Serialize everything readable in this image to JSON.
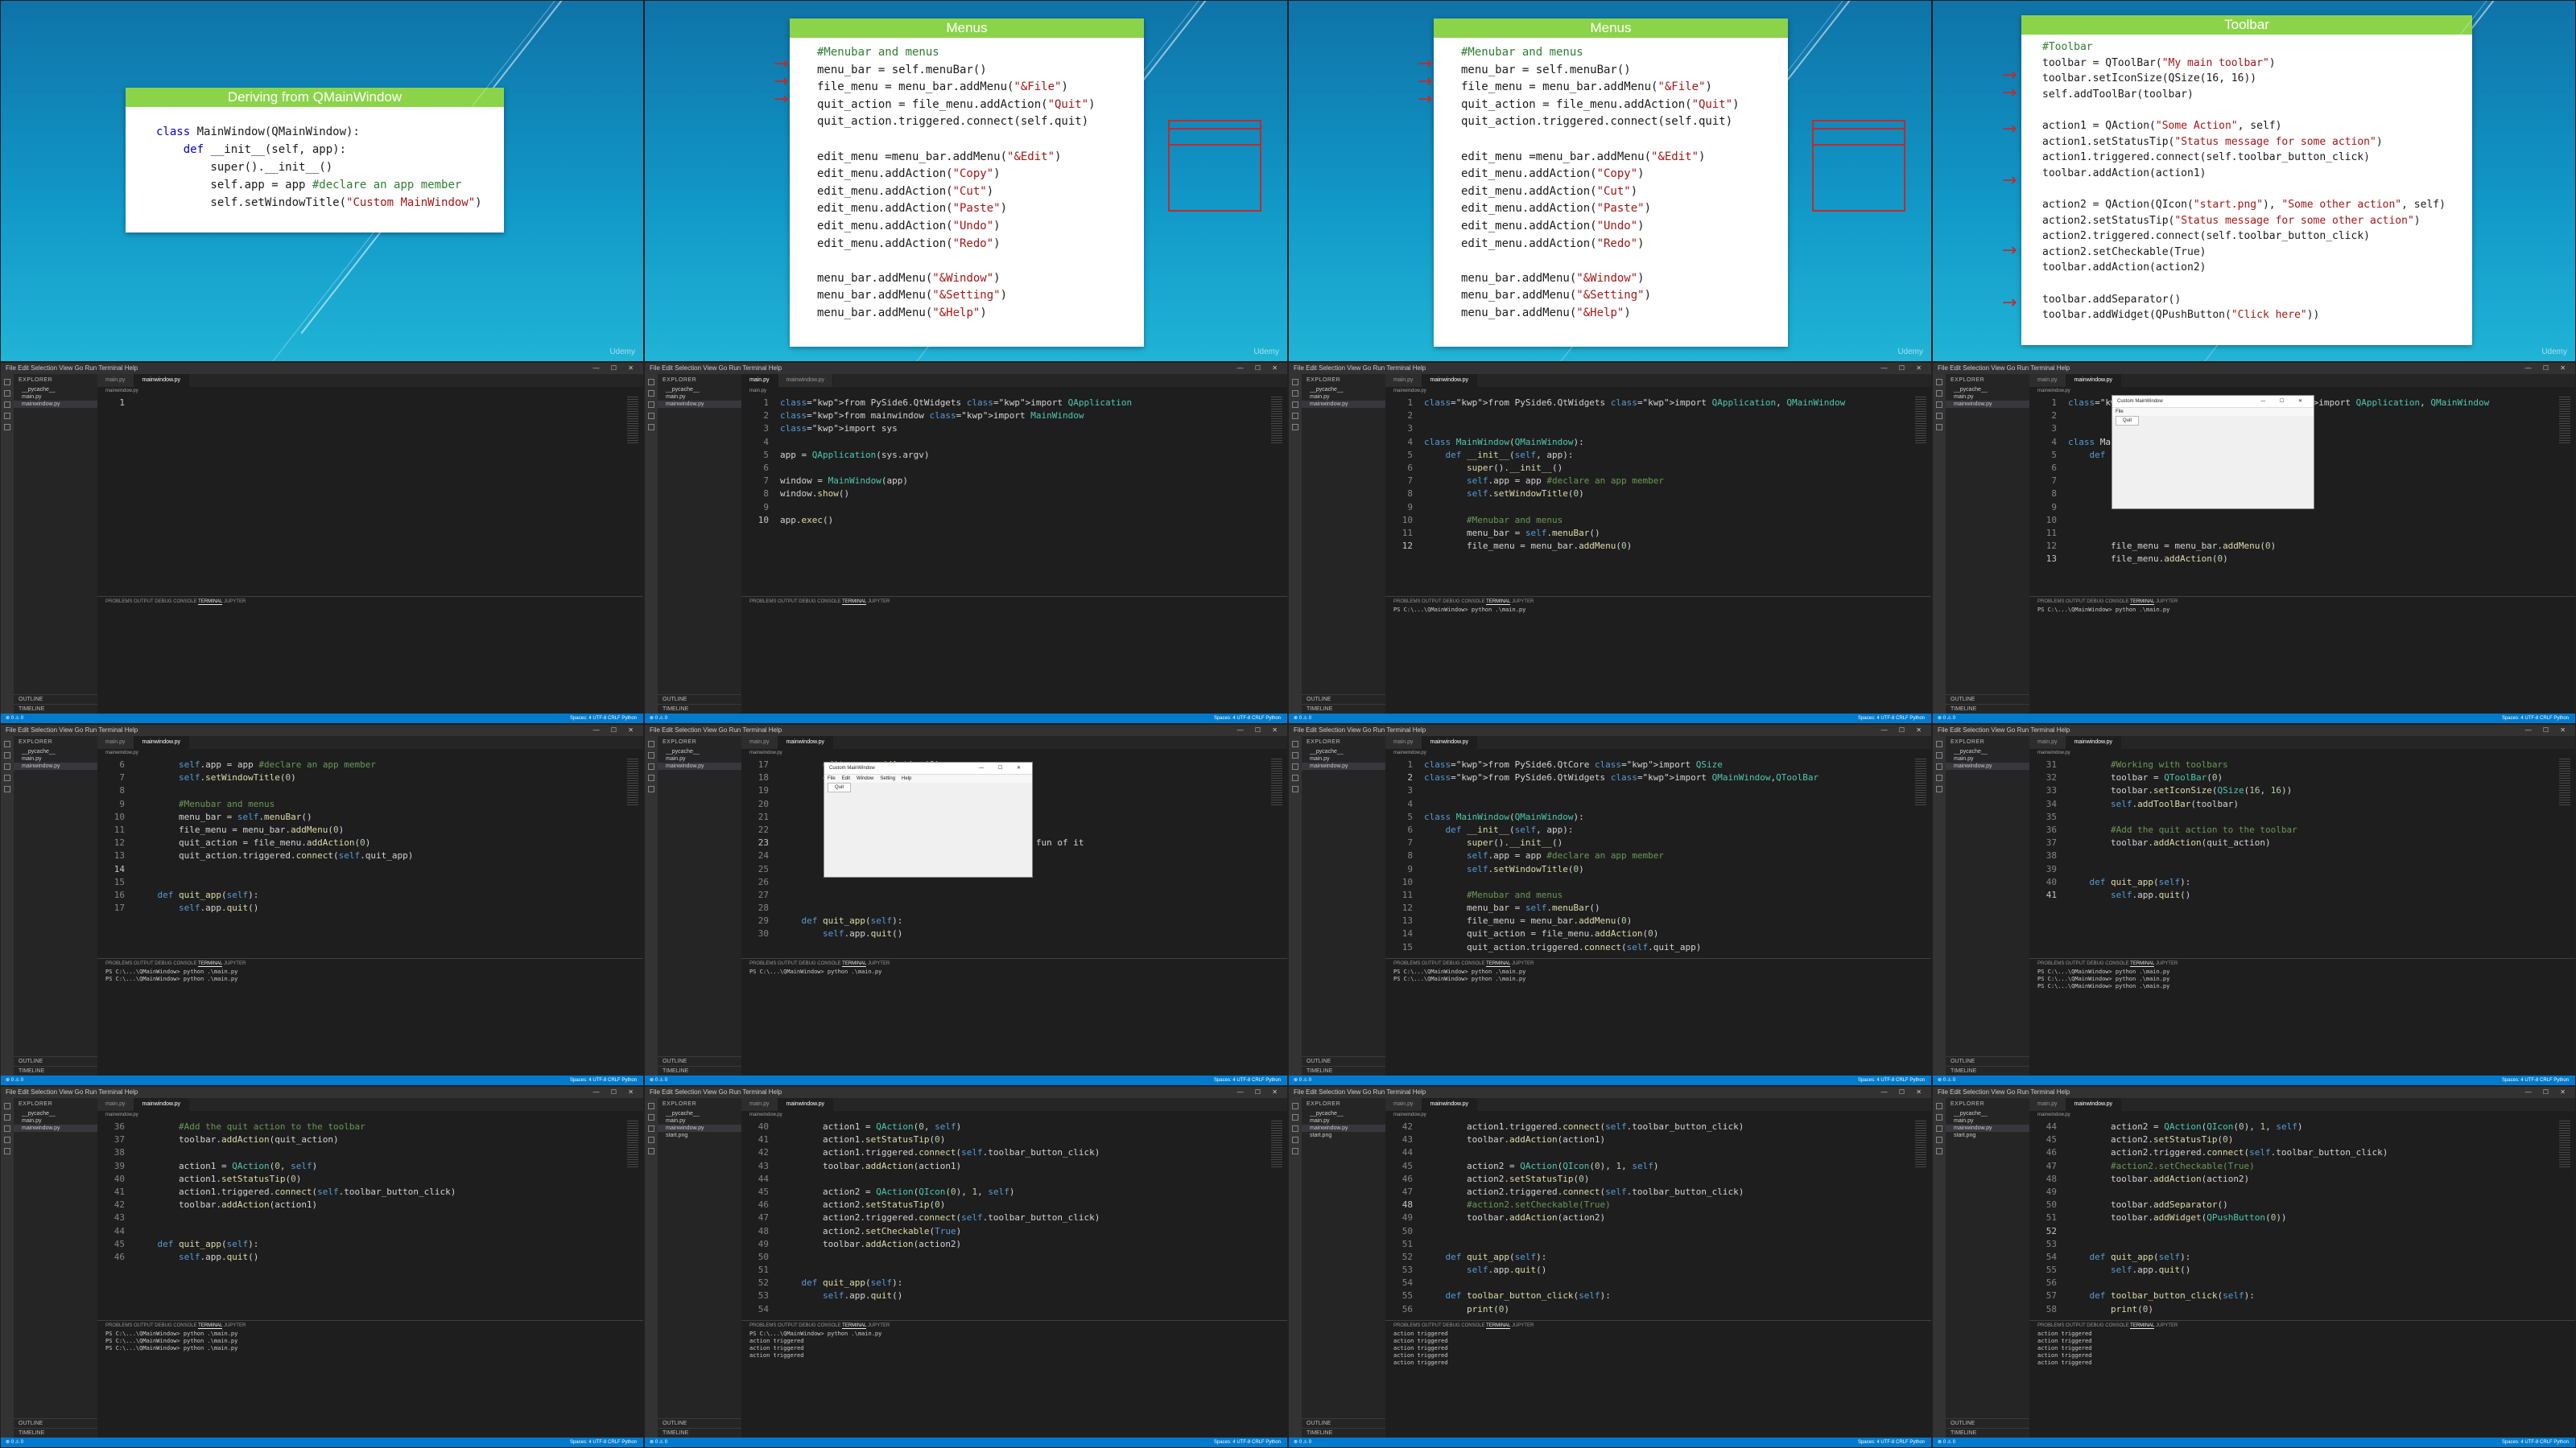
{
  "slides": [
    {
      "title": "Deriving from QMainWindow",
      "code": [
        "class MainWindow(QMainWindow):",
        "    def __init__(self, app):",
        "        super().__init__()",
        "        self.app = app #declare an app member",
        "        self.setWindowTitle(\"Custom MainWindow\")"
      ],
      "watermark": "Udemy"
    },
    {
      "title": "Menus",
      "code": [
        "#Menubar and menus",
        "menu_bar = self.menuBar()",
        "file_menu = menu_bar.addMenu(\"&File\")",
        "quit_action = file_menu.addAction(\"Quit\")",
        "quit_action.triggered.connect(self.quit)",
        "",
        "edit_menu =menu_bar.addMenu(\"&Edit\")",
        "edit_menu.addAction(\"Copy\")",
        "edit_menu.addAction(\"Cut\")",
        "edit_menu.addAction(\"Paste\")",
        "edit_menu.addAction(\"Undo\")",
        "edit_menu.addAction(\"Redo\")",
        "",
        "menu_bar.addMenu(\"&Window\")",
        "menu_bar.addMenu(\"&Setting\")",
        "menu_bar.addMenu(\"&Help\")"
      ],
      "watermark": "Udemy"
    },
    {
      "title": "Menus",
      "code": [
        "#Menubar and menus",
        "menu_bar = self.menuBar()",
        "file_menu = menu_bar.addMenu(\"&File\")",
        "quit_action = file_menu.addAction(\"Quit\")",
        "quit_action.triggered.connect(self.quit)",
        "",
        "edit_menu =menu_bar.addMenu(\"&Edit\")",
        "edit_menu.addAction(\"Copy\")",
        "edit_menu.addAction(\"Cut\")",
        "edit_menu.addAction(\"Paste\")",
        "edit_menu.addAction(\"Undo\")",
        "edit_menu.addAction(\"Redo\")",
        "",
        "menu_bar.addMenu(\"&Window\")",
        "menu_bar.addMenu(\"&Setting\")",
        "menu_bar.addMenu(\"&Help\")"
      ],
      "watermark": "Udemy"
    },
    {
      "title": "Toolbar",
      "code": [
        "#Toolbar",
        "toolbar = QToolBar(\"My main toolbar\")",
        "toolbar.setIconSize(QSize(16, 16))",
        "self.addToolBar(toolbar)",
        "",
        "action1 = QAction(\"Some Action\", self)",
        "action1.setStatusTip(\"Status message for some action\")",
        "action1.triggered.connect(self.toolbar_button_click)",
        "toolbar.addAction(action1)",
        "",
        "action2 = QAction(QIcon(\"start.png\"), \"Some other action\", self)",
        "action2.setStatusTip(\"Status message for some other action\")",
        "action2.triggered.connect(self.toolbar_button_click)",
        "action2.setCheckable(True)",
        "toolbar.addAction(action2)",
        "",
        "toolbar.addSeparator()",
        "toolbar.addWidget(QPushButton(\"Click here\"))"
      ],
      "watermark": "Udemy"
    }
  ],
  "vscode": {
    "menu": "File  Edit  Selection  View  Go  Run  Terminal  Help",
    "window_controls": "— ☐ ✕",
    "explorer_header": "EXPLORER",
    "outline": "OUTLINE",
    "timeline": "TIMELINE",
    "panel_tabs": [
      "PROBLEMS",
      "OUTPUT",
      "DEBUG CONSOLE",
      "TERMINAL",
      "JUPYTER"
    ],
    "status_left": "⊗ 0 ⚠ 0",
    "status_right": "Spaces: 4  UTF-8  CRLF  Python"
  },
  "editors": [
    {
      "tabs": [
        "main.py",
        "mainwindow.py"
      ],
      "active": 1,
      "files": [
        "__pycache__",
        "main.py",
        "mainwindow.py"
      ],
      "start": 1,
      "cursor": 1,
      "lines": [
        ""
      ],
      "terminal": []
    },
    {
      "tabs": [
        "main.py",
        "mainwindow.py"
      ],
      "active": 0,
      "files": [
        "__pycache__",
        "main.py",
        "mainwindow.py"
      ],
      "start": 1,
      "cursor": 10,
      "lines": [
        "from PySide6.QtWidgets import QApplication",
        "from mainwindow import MainWindow",
        "import sys",
        "",
        "app = QApplication(sys.argv)",
        "",
        "window = MainWindow(app)",
        "window.show()",
        "",
        "app.exec()"
      ],
      "terminal": []
    },
    {
      "tabs": [
        "main.py",
        "mainwindow.py"
      ],
      "active": 1,
      "files": [
        "__pycache__",
        "main.py",
        "mainwindow.py"
      ],
      "start": 1,
      "cursor": 12,
      "lines": [
        "from PySide6.QtWidgets import QApplication, QMainWindow",
        "",
        "",
        "class MainWindow(QMainWindow):",
        "    def __init__(self, app):",
        "        super().__init__()",
        "        self.app = app #declare an app member",
        "        self.setWindowTitle(\"Custom MainWindow\")",
        "",
        "        #Menubar and menus",
        "        menu_bar = self.menuBar()",
        "        file_menu = menu_bar.addMenu(\"&File\")"
      ],
      "terminal": [
        "PS C:\\...\\QMainWindow> python .\\main.py"
      ]
    },
    {
      "tabs": [
        "main.py",
        "mainwindow.py"
      ],
      "active": 1,
      "files": [
        "__pycache__",
        "main.py",
        "mainwindow.py"
      ],
      "start": 1,
      "cursor": 13,
      "lines": [
        "from PySide6.QtWidgets import QApplication, QMainWindow",
        "",
        "",
        "class Ma",
        "    def",
        "",
        "",
        "",
        "",
        "",
        "",
        "        file_menu = menu_bar.addMenu(\"&File\")",
        "        file_menu.addAction(\"Quit\")"
      ],
      "app_window": {
        "title": "Custom MainWindow",
        "menus": [
          "File"
        ],
        "drop": [
          "Quit"
        ]
      },
      "terminal": [
        "PS C:\\...\\QMainWindow> python .\\main.py"
      ]
    },
    {
      "tabs": [
        "main.py",
        "mainwindow.py"
      ],
      "active": 1,
      "files": [
        "__pycache__",
        "main.py",
        "mainwindow.py"
      ],
      "start": 6,
      "cursor": 14,
      "lines": [
        "        self.app = app #declare an app member",
        "        self.setWindowTitle(\"Custom MainWindow\")",
        "",
        "        #Menubar and menus",
        "        menu_bar = self.menuBar()",
        "        file_menu = menu_bar.addMenu(\"&File\")",
        "        quit_action = file_menu.addAction(\"Quit\")",
        "        quit_action.triggered.connect(self.quit_app)",
        "",
        "",
        "    def quit_app(self):",
        "        self.app.quit()"
      ],
      "terminal": [
        "PS C:\\...\\QMainWindow> python .\\main.py",
        "PS C:\\...\\QMainWindow> python .\\main.py"
      ]
    },
    {
      "tabs": [
        "main.py",
        "mainwindow.py"
      ],
      "active": 1,
      "files": [
        "__pycache__",
        "main.py",
        "mainwindow.py"
      ],
      "start": 17,
      "cursor": 23,
      "lines": [
        "        edit_menu.addAction(\"Copy\")",
        "        edit_menu.addAction(\"Cut\")",
        "",
        "",
        "",
        "",
        "                                            the fun of it",
        "",
        "",
        "",
        "",
        "",
        "    def quit_app(self):",
        "        self.app.quit()"
      ],
      "app_window": {
        "title": "Custom MainWindow",
        "menus": [
          "File",
          "Edit",
          "Window",
          "Setting",
          "Help"
        ],
        "drop": [
          "Quit"
        ]
      },
      "terminal": [
        "PS C:\\...\\QMainWindow> python .\\main.py"
      ]
    },
    {
      "tabs": [
        "main.py",
        "mainwindow.py"
      ],
      "active": 1,
      "files": [
        "__pycache__",
        "main.py",
        "mainwindow.py"
      ],
      "start": 1,
      "cursor": 2,
      "lines": [
        "from PySide6.QtCore import QSize",
        "from PySide6.QtWidgets import QMainWindow,QToolBar",
        "",
        "",
        "class MainWindow(QMainWindow):",
        "    def __init__(self, app):",
        "        super().__init__()",
        "        self.app = app #declare an app member",
        "        self.setWindowTitle(\"Custom MainWindow\")",
        "",
        "        #Menubar and menus",
        "        menu_bar = self.menuBar()",
        "        file_menu = menu_bar.addMenu(\"File\")",
        "        quit_action = file_menu.addAction(\"Quit\")",
        "        quit_action.triggered.connect(self.quit_app)"
      ],
      "terminal": [
        "PS C:\\...\\QMainWindow> python .\\main.py",
        "PS C:\\...\\QMainWindow> python .\\main.py"
      ]
    },
    {
      "tabs": [
        "main.py",
        "mainwindow.py"
      ],
      "active": 1,
      "files": [
        "__pycache__",
        "main.py",
        "mainwindow.py"
      ],
      "start": 31,
      "cursor": 41,
      "lines": [
        "        #Working with toolbars",
        "        toolbar = QToolBar(\"My main toolbar\")",
        "        toolbar.setIconSize(QSize(16, 16))",
        "        self.addToolBar(toolbar)",
        "",
        "        #Add the quit action to the toolbar",
        "        toolbar.addAction(quit_action)",
        "",
        "",
        "    def quit_app(self):",
        "        self.app.quit()"
      ],
      "terminal": [
        "PS C:\\...\\QMainWindow> python .\\main.py",
        "PS C:\\...\\QMainWindow> python .\\main.py",
        "PS C:\\...\\QMainWindow> python .\\main.py"
      ]
    },
    {
      "tabs": [
        "main.py",
        "mainwindow.py"
      ],
      "active": 1,
      "files": [
        "__pycache__",
        "main.py",
        "mainwindow.py"
      ],
      "start": 36,
      "cursor": 47,
      "lines": [
        "        #Add the quit action to the toolbar",
        "        toolbar.addAction(quit_action)",
        "",
        "        action1 = QAction(\"Some Action\", self)",
        "        action1.setStatusTip(\"Status message for some action\")",
        "        action1.triggered.connect(self.toolbar_button_click)",
        "        toolbar.addAction(action1)",
        "",
        "",
        "    def quit_app(self):",
        "        self.app.quit()"
      ],
      "terminal": [
        "PS C:\\...\\QMainWindow> python .\\main.py",
        "PS C:\\...\\QMainWindow> python .\\main.py",
        "PS C:\\...\\QMainWindow> python .\\main.py"
      ]
    },
    {
      "tabs": [
        "main.py",
        "mainwindow.py"
      ],
      "active": 1,
      "files": [
        "__pycache__",
        "main.py",
        "mainwindow.py",
        "start.png"
      ],
      "start": 40,
      "cursor": 0,
      "lines": [
        "        action1 = QAction(\"Some Action\", self)",
        "        action1.setStatusTip(\"Status message for some action\")",
        "        action1.triggered.connect(self.toolbar_button_click)",
        "        toolbar.addAction(action1)",
        "",
        "        action2 = QAction(QIcon(\"start.png\"), \"Some other action\", self)",
        "        action2.setStatusTip(\"Status message for some other action\")",
        "        action2.triggered.connect(self.toolbar_button_click)",
        "        action2.setCheckable(True)",
        "        toolbar.addAction(action2)",
        "",
        "",
        "    def quit_app(self):",
        "        self.app.quit()",
        "",
        "    def toolbar_button_click(self):"
      ],
      "terminal": [
        "PS C:\\...\\QMainWindow> python .\\main.py",
        "action triggered",
        "action triggered",
        "action triggered"
      ]
    },
    {
      "tabs": [
        "main.py",
        "mainwindow.py"
      ],
      "active": 1,
      "files": [
        "__pycache__",
        "main.py",
        "mainwindow.py",
        "start.png"
      ],
      "start": 42,
      "cursor": 48,
      "lines": [
        "        action1.triggered.connect(self.toolbar_button_click)",
        "        toolbar.addAction(action1)",
        "",
        "        action2 = QAction(QIcon(\"start.png\"), \"Some other action\", self)",
        "        action2.setStatusTip(\"Status message for some other action\")",
        "        action2.triggered.connect(self.toolbar_button_click)",
        "        #action2.setCheckable(True)",
        "        toolbar.addAction(action2)",
        "",
        "",
        "    def quit_app(self):",
        "        self.app.quit()",
        "",
        "    def toolbar_button_click(self):",
        "        print(\"action triggered\")"
      ],
      "terminal": [
        "action triggered",
        "action triggered",
        "action triggered",
        "action triggered",
        "action triggered"
      ]
    },
    {
      "tabs": [
        "main.py",
        "mainwindow.py"
      ],
      "active": 1,
      "files": [
        "__pycache__",
        "main.py",
        "mainwindow.py",
        "start.png"
      ],
      "start": 44,
      "cursor": 52,
      "lines": [
        "        action2 = QAction(QIcon(\"start.png\"), \"Some other action\", self)",
        "        action2.setStatusTip(\"Status message for some other action\")",
        "        action2.triggered.connect(self.toolbar_button_click)",
        "        #action2.setCheckable(True)",
        "        toolbar.addAction(action2)",
        "",
        "        toolbar.addSeparator()",
        "        toolbar.addWidget(QPushButton(\"Click here\"))",
        "",
        "",
        "    def quit_app(self):",
        "        self.app.quit()",
        "",
        "    def toolbar_button_click(self):",
        "        print(\"action triggered\")"
      ],
      "terminal": [
        "action triggered",
        "action triggered",
        "action triggered",
        "action triggered",
        "action triggered"
      ]
    }
  ],
  "colors": {
    "slide_header": "#8bd44a",
    "status_bar": "#007acc",
    "editor_bg": "#1e1e1e",
    "annotation_red": "#c62828"
  }
}
